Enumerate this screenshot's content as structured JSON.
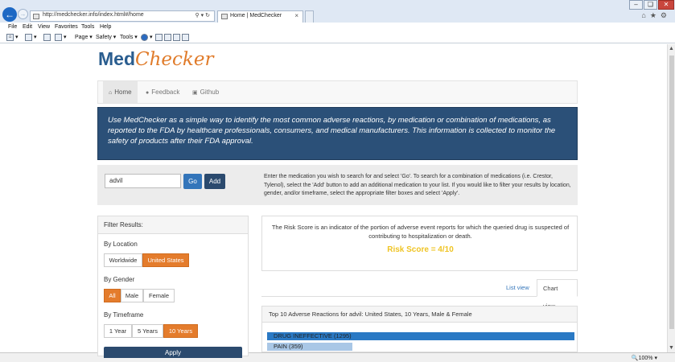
{
  "browser": {
    "url": "http://medchecker.info/index.html#/home",
    "tab_title": "Home | MedChecker",
    "tab_close": "×",
    "menu": [
      "File",
      "Edit",
      "View",
      "Favorites",
      "Tools",
      "Help"
    ],
    "commands": {
      "page": "Page",
      "safety": "Safety",
      "tools": "Tools"
    },
    "zoom": "100%"
  },
  "logo": {
    "part1": "Med",
    "part2": "Checker"
  },
  "nav": {
    "home": "Home",
    "feedback": "Feedback",
    "github": "Github"
  },
  "hero_text": "Use MedChecker as a simple way to identify the most common adverse reactions, by medication or combination of medications, as reported to the FDA by healthcare professionals, consumers, and medical manufacturers. This information is collected to monitor the safety of products after their FDA approval.",
  "search": {
    "value": "advil",
    "go_label": "Go",
    "add_label": "Add",
    "instructions": "Enter the medication you wish to search for and select 'Go'. To search for a combination of medications (i.e. Crestor, Tylenol), select the 'Add' button to add an additional medication to your list. If you would like to filter your results by location, gender, and/or timeframe, select the appropriate filter boxes and select 'Apply'."
  },
  "filters": {
    "title": "Filter Results:",
    "location_label": "By Location",
    "location_options": [
      "Worldwide",
      "United States"
    ],
    "location_selected": "United States",
    "gender_label": "By Gender",
    "gender_options": [
      "All",
      "Male",
      "Female"
    ],
    "gender_selected": "All",
    "timeframe_label": "By Timeframe",
    "timeframe_options": [
      "1 Year",
      "5 Years",
      "10 Years"
    ],
    "timeframe_selected": "10 Years",
    "apply_label": "Apply"
  },
  "risk": {
    "description": "The Risk Score is an indicator of the portion of adverse event reports for which the queried drug is suspected of contributing to hospitalization or death.",
    "score_text": "Risk Score = 4/10"
  },
  "views": {
    "list": "List view",
    "chart": "Chart view",
    "selected": "Chart view"
  },
  "reactions": {
    "title": "Top 10 Adverse Reactions for advil: United States, 10 Years, Male & Female",
    "items": [
      {
        "label": "DRUG INEFFECTIVE (1295)",
        "count": 1295
      },
      {
        "label": "PAIN (359)",
        "count": 359
      }
    ]
  },
  "colors": {
    "brand_blue": "#2b5078",
    "accent_orange": "#e47c2c",
    "risk_yellow": "#efc424",
    "bar_primary": "#2a79c4",
    "bar_secondary": "#a9c7e6"
  }
}
